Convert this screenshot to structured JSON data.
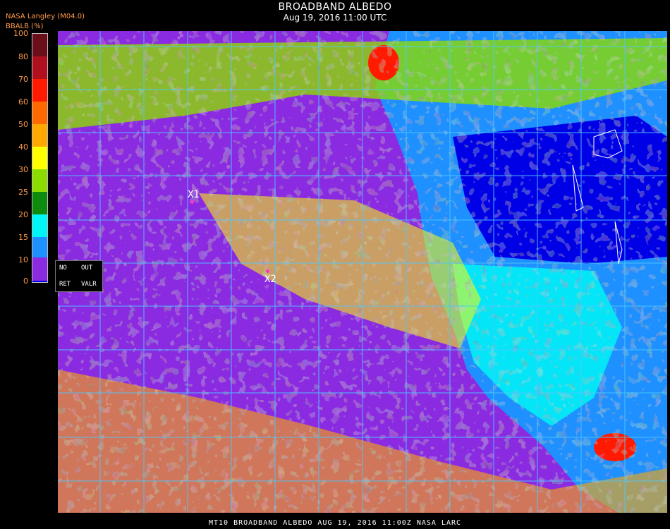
{
  "header": {
    "title": "BROADBAND ALBEDO",
    "subtitle": "Aug 19, 2016 11:00 UTC",
    "source": "NASA Langley (M04.0)",
    "colorbar_title": "BBALB (%)"
  },
  "colorbar": {
    "ticks": [
      "100",
      "80",
      "70",
      "60",
      "50",
      "40",
      "30",
      "25",
      "20",
      "15",
      "10",
      "0"
    ],
    "colors": [
      "#6a0f1a",
      "#b0101e",
      "#ff1a00",
      "#ff6a00",
      "#ffa800",
      "#ffff00",
      "#8cdc00",
      "#0e8a0e",
      "#00f6f6",
      "#1e90ff",
      "#0000e6",
      "#8a2be2"
    ]
  },
  "legend_box": {
    "no": "NO",
    "out": "OUT",
    "ret": "RET",
    "valr": "VALR"
  },
  "markers": {
    "m1": "X1",
    "m2": "X2"
  },
  "footer": {
    "text": "MT10  BROADBAND ALBEDO   AUG 19, 2016 11:00Z   NASA LARC"
  }
}
